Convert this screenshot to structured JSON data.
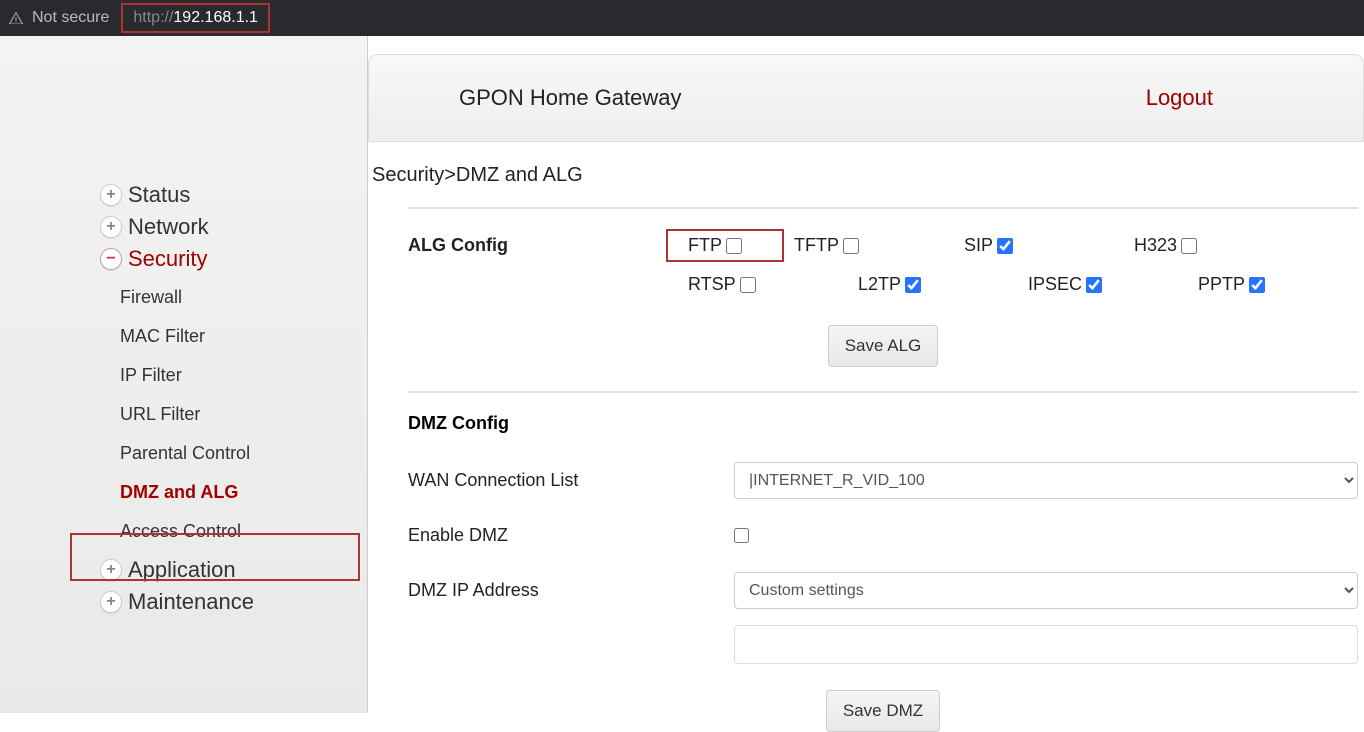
{
  "browser": {
    "not_secure": "Not secure",
    "url_prefix": "http://",
    "url_host": "192.168.1.1"
  },
  "sidebar": {
    "items": [
      {
        "label": "Status",
        "expanded": false
      },
      {
        "label": "Network",
        "expanded": false
      },
      {
        "label": "Security",
        "expanded": true,
        "subitems": [
          "Firewall",
          "MAC Filter",
          "IP Filter",
          "URL Filter",
          "Parental Control",
          "DMZ and ALG",
          "Access Control"
        ],
        "active_sub": "DMZ and ALG"
      },
      {
        "label": "Application",
        "expanded": false
      },
      {
        "label": "Maintenance",
        "expanded": false
      }
    ]
  },
  "header": {
    "title": "GPON Home Gateway",
    "logout": "Logout"
  },
  "breadcrumb": "Security>DMZ and ALG",
  "alg": {
    "heading": "ALG Config",
    "items": [
      {
        "id": "ftp",
        "label": "FTP",
        "checked": false
      },
      {
        "id": "tftp",
        "label": "TFTP",
        "checked": false
      },
      {
        "id": "sip",
        "label": "SIP",
        "checked": true
      },
      {
        "id": "h323",
        "label": "H323",
        "checked": false
      },
      {
        "id": "rtsp",
        "label": "RTSP",
        "checked": false
      },
      {
        "id": "l2tp",
        "label": "L2TP",
        "checked": true
      },
      {
        "id": "ipsec",
        "label": "IPSEC",
        "checked": true
      },
      {
        "id": "pptp",
        "label": "PPTP",
        "checked": true
      }
    ],
    "save_btn": "Save ALG"
  },
  "dmz": {
    "heading": "DMZ Config",
    "wan_label": "WAN Connection List",
    "wan_value": "        |INTERNET_R_VID_100",
    "enable_label": "Enable DMZ",
    "enable_checked": false,
    "ip_label": "DMZ IP Address",
    "ip_select": "Custom settings",
    "ip_value": "",
    "save_btn": "Save DMZ"
  }
}
